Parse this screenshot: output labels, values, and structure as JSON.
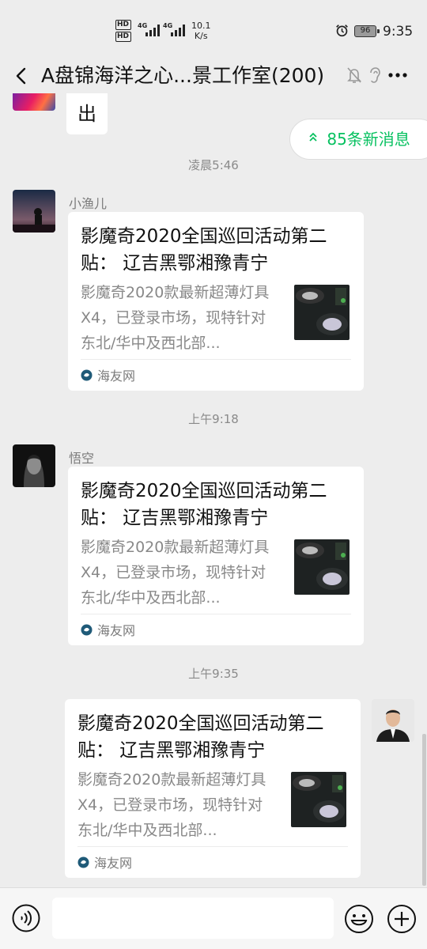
{
  "status_bar": {
    "hd1": "HD",
    "hd2": "HD",
    "net1": "4G",
    "net2": "4G",
    "speed_value": "10.1",
    "speed_unit": "K/s",
    "battery": "96",
    "time": "9:35"
  },
  "header": {
    "title": "A盘锦海洋之心...景工作室(200)"
  },
  "chat": {
    "prev_text": "出",
    "new_messages_label": "85条新消息",
    "messages": [
      {
        "time": "凌晨5:46",
        "sender": "小渔儿",
        "card": {
          "title": "影魔奇2020全国巡回活动第二贴： 辽吉黑鄂湘豫青宁",
          "desc": "影魔奇2020款最新超薄灯具X4，已登录市场，现特针对东北/华中及西北部...",
          "source": "海友网"
        }
      },
      {
        "time": "上午9:18",
        "sender": "悟空",
        "card": {
          "title": "影魔奇2020全国巡回活动第二贴： 辽吉黑鄂湘豫青宁",
          "desc": "影魔奇2020款最新超薄灯具X4，已登录市场，现特针对东北/华中及西北部...",
          "source": "海友网"
        }
      },
      {
        "time": "上午9:35",
        "sender": "",
        "card": {
          "title": "影魔奇2020全国巡回活动第二贴： 辽吉黑鄂湘豫青宁",
          "desc": "影魔奇2020款最新超薄灯具X4，已登录市场，现特针对东北/华中及西北部...",
          "source": "海友网"
        }
      }
    ]
  },
  "input": {
    "value": "",
    "placeholder": ""
  },
  "colors": {
    "accent": "#07c160",
    "background": "#ededed"
  }
}
